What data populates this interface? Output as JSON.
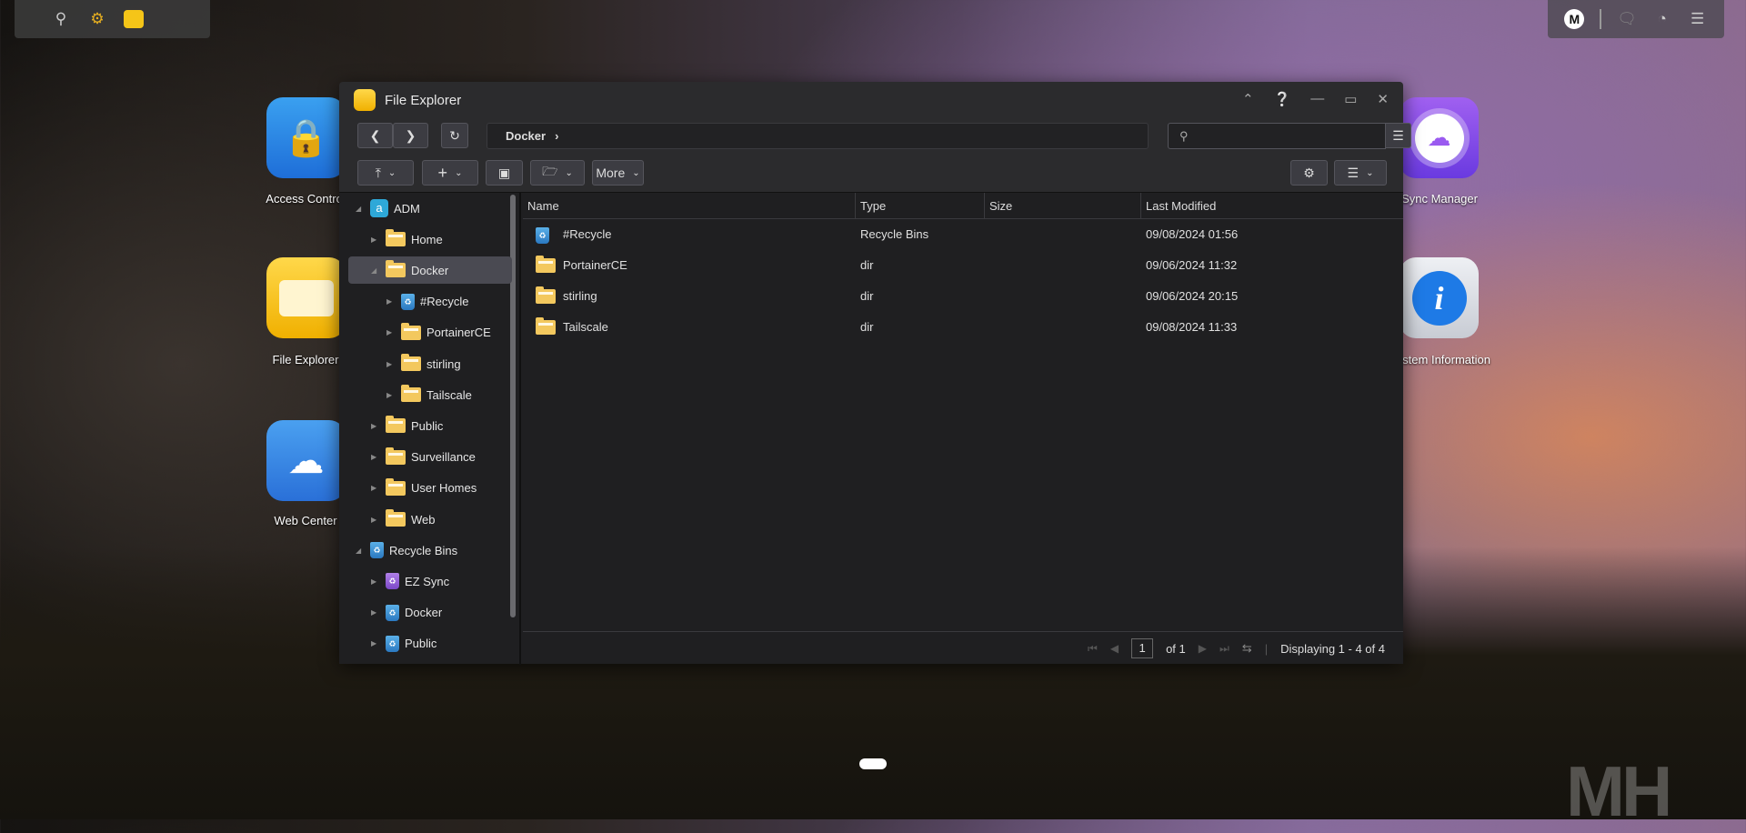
{
  "taskbar": {
    "icons": [
      "search-icon",
      "settings-icon",
      "file-explorer-icon"
    ]
  },
  "tray": {
    "avatar": "M",
    "icons": [
      "chat-icon",
      "dashboard-icon",
      "controls-icon"
    ]
  },
  "desktop": {
    "left": [
      {
        "label": "Access Control",
        "icon": "access-control-icon",
        "color": "#2e8ae6"
      },
      {
        "label": "File Explorer",
        "icon": "file-explorer-icon",
        "color": "#f5c518"
      },
      {
        "label": "Web Center",
        "icon": "web-center-icon",
        "color": "#3a8ae6"
      }
    ],
    "right": [
      {
        "label": "Sync Manager",
        "icon": "sync-manager-icon",
        "color": "#8a4ae6"
      },
      {
        "label": "System Information",
        "icon": "info-icon",
        "color": "#d8dce4"
      }
    ]
  },
  "window": {
    "title": "File Explorer",
    "breadcrumb": [
      "Docker"
    ],
    "search": {
      "placeholder": ""
    },
    "toolbar": {
      "more": "More"
    },
    "tree": [
      {
        "label": "ADM",
        "level": 0,
        "icon": "adm",
        "expanded": true
      },
      {
        "label": "Home",
        "level": 1,
        "icon": "share"
      },
      {
        "label": "Docker",
        "level": 1,
        "icon": "share",
        "expanded": true,
        "selected": true
      },
      {
        "label": "#Recycle",
        "level": 2,
        "icon": "bin"
      },
      {
        "label": "PortainerCE",
        "level": 2,
        "icon": "folder"
      },
      {
        "label": "stirling",
        "level": 2,
        "icon": "folder"
      },
      {
        "label": "Tailscale",
        "level": 2,
        "icon": "folder"
      },
      {
        "label": "Public",
        "level": 1,
        "icon": "share"
      },
      {
        "label": "Surveillance",
        "level": 1,
        "icon": "share"
      },
      {
        "label": "User Homes",
        "level": 1,
        "icon": "share"
      },
      {
        "label": "Web",
        "level": 1,
        "icon": "share"
      },
      {
        "label": "Recycle Bins",
        "level": 0,
        "icon": "bin",
        "expanded": true
      },
      {
        "label": "EZ Sync",
        "level": 1,
        "icon": "bin-purple"
      },
      {
        "label": "Docker",
        "level": 1,
        "icon": "bin"
      },
      {
        "label": "Public",
        "level": 1,
        "icon": "bin"
      }
    ],
    "columns": [
      "Name",
      "Type",
      "Size",
      "Last Modified"
    ],
    "files": [
      {
        "name": "#Recycle",
        "type": "Recycle Bins",
        "size": "",
        "modified": "09/08/2024 01:56",
        "icon": "bin"
      },
      {
        "name": "PortainerCE",
        "type": "dir",
        "size": "",
        "modified": "09/06/2024 11:32",
        "icon": "folder"
      },
      {
        "name": "stirling",
        "type": "dir",
        "size": "",
        "modified": "09/06/2024 20:15",
        "icon": "folder"
      },
      {
        "name": "Tailscale",
        "type": "dir",
        "size": "",
        "modified": "09/08/2024 11:33",
        "icon": "folder"
      }
    ],
    "pager": {
      "page": "1",
      "of": "of 1",
      "display": "Displaying 1 - 4 of 4"
    }
  },
  "watermark": "MH"
}
